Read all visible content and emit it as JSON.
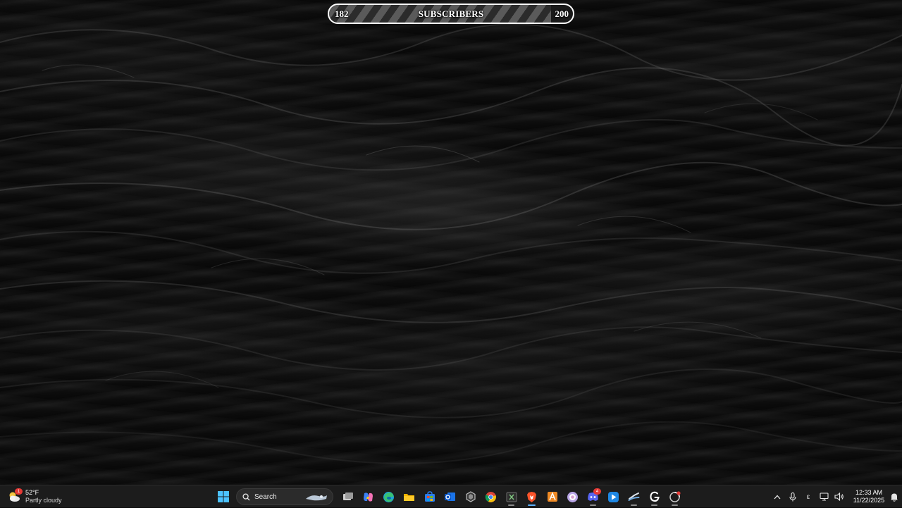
{
  "goal": {
    "current": "182",
    "target": "200",
    "label": "SUBSCRIBERS",
    "progress": 0.91
  },
  "taskbar": {
    "weather": {
      "temperature": "52°F",
      "condition": "Partly cloudy",
      "alert_count": "1"
    },
    "search": {
      "label": "Search"
    },
    "apps": [
      {
        "name": "start",
        "icon": "windows-start-icon"
      },
      {
        "name": "task-view",
        "icon": "task-view-icon"
      },
      {
        "name": "copilot",
        "icon": "copilot-icon"
      },
      {
        "name": "edge",
        "icon": "edge-icon"
      },
      {
        "name": "file-explorer",
        "icon": "folder-icon"
      },
      {
        "name": "store",
        "icon": "store-icon"
      },
      {
        "name": "outlook",
        "icon": "outlook-icon"
      },
      {
        "name": "app-hex",
        "icon": "hexagon-icon"
      },
      {
        "name": "chrome",
        "icon": "chrome-icon"
      },
      {
        "name": "excel",
        "icon": "excel-icon"
      },
      {
        "name": "brave",
        "icon": "brave-icon"
      },
      {
        "name": "app-orange",
        "icon": "orange-a-icon"
      },
      {
        "name": "app-purple",
        "icon": "purple-circle-icon"
      },
      {
        "name": "discord",
        "icon": "discord-icon",
        "badge": "4"
      },
      {
        "name": "app-blue",
        "icon": "blue-play-icon"
      },
      {
        "name": "steam",
        "icon": "steam-icon"
      },
      {
        "name": "app-g",
        "icon": "g-logo-icon"
      },
      {
        "name": "app-spinner",
        "icon": "spinner-icon"
      }
    ],
    "tray": {
      "ime": "ε",
      "time": "12:33 AM",
      "date": "11/22/2025"
    }
  },
  "colors": {
    "taskbar_bg": "#1c1c1c",
    "accent": "#5fb2ff",
    "goal_border": "#ffffff"
  }
}
